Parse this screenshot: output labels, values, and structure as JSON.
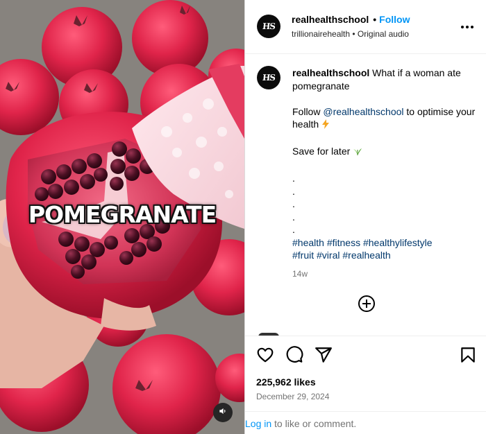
{
  "media": {
    "overlay_text": "POMEGRANATE"
  },
  "header": {
    "username": "realhealthschool",
    "separator": "•",
    "follow_label": "Follow",
    "audio_line": "trillionairehealth • Original audio",
    "avatar_initials": "HS"
  },
  "caption": {
    "username": "realhealthschool",
    "text": "What if a woman ate pomegranate",
    "follow_prefix": "Follow",
    "mention": "@realhealthschool",
    "follow_suffix": "to optimise your health",
    "follow_emoji": "lightning-emoji",
    "save_text": "Save for later",
    "save_emoji": "herb-emoji",
    "dots": [
      ".",
      ".",
      ".",
      ".",
      "."
    ],
    "hashtags_line1": [
      "#health",
      "#fitness",
      "#healthylifestyle"
    ],
    "hashtags_line2": [
      "#fruit",
      "#viral",
      "#realhealth"
    ],
    "time_ago": "14w"
  },
  "actions": {
    "icons": [
      "heart-icon",
      "comment-icon",
      "share-icon",
      "bookmark-icon"
    ],
    "likes": "225,962 likes",
    "date": "December 29, 2024",
    "login_link": "Log in",
    "login_text": "to like or comment."
  },
  "colors": {
    "accent": "#0095f6",
    "link": "#00376b",
    "muted": "#737373",
    "border": "#dbdbdb"
  }
}
